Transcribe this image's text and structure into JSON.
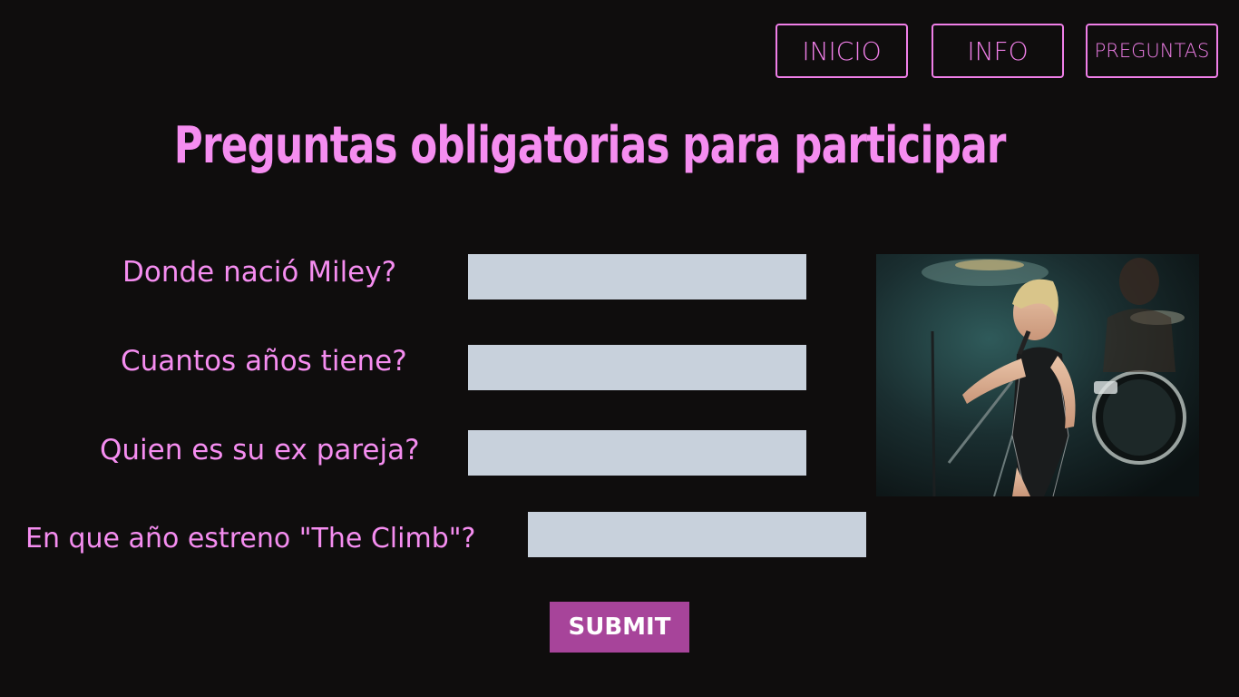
{
  "nav": {
    "inicio": "INICIO",
    "info": "INFO",
    "preguntas": "PREGUNTAS"
  },
  "title": "Preguntas obligatorias para participar",
  "questions": [
    {
      "label": "Donde nació Miley?",
      "value": ""
    },
    {
      "label": "Cuantos años tiene?",
      "value": ""
    },
    {
      "label": "Quien es su ex pareja?",
      "value": ""
    },
    {
      "label": "En que año estreno \"The Climb\"?",
      "value": ""
    }
  ],
  "submit_label": "SUBMIT",
  "colors": {
    "background": "#0f0d0d",
    "accent_pink": "#f58df0",
    "input_bg": "#c8d1dc",
    "submit_bg": "#a7449a"
  }
}
